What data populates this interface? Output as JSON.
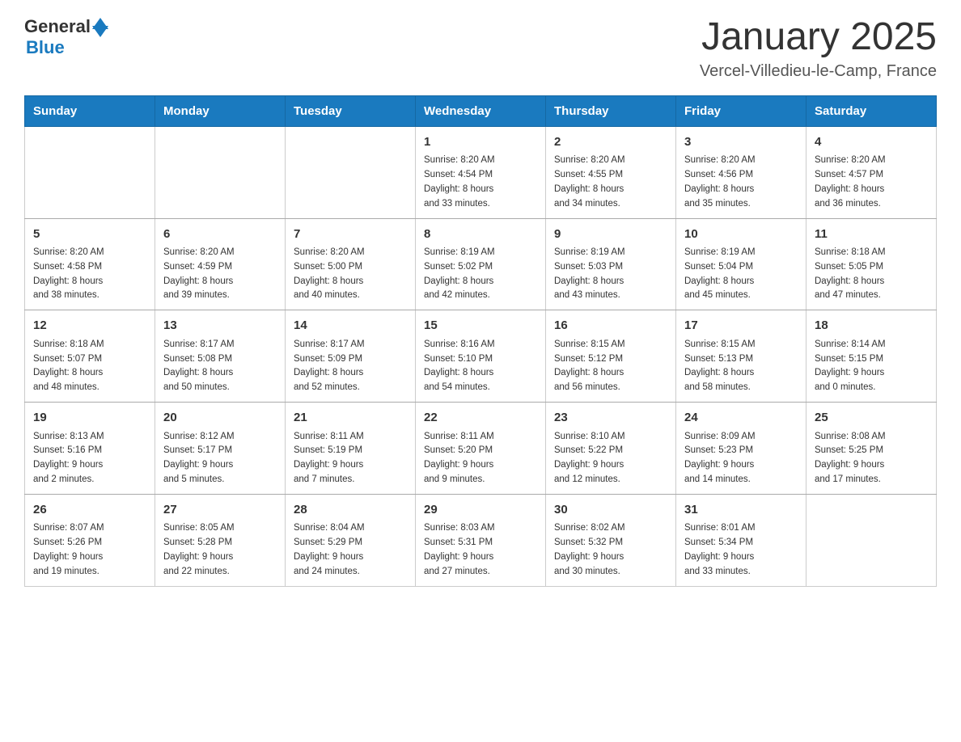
{
  "logo": {
    "general": "General",
    "blue": "Blue"
  },
  "title": "January 2025",
  "location": "Vercel-Villedieu-le-Camp, France",
  "days_of_week": [
    "Sunday",
    "Monday",
    "Tuesday",
    "Wednesday",
    "Thursday",
    "Friday",
    "Saturday"
  ],
  "weeks": [
    [
      {
        "num": "",
        "info": ""
      },
      {
        "num": "",
        "info": ""
      },
      {
        "num": "",
        "info": ""
      },
      {
        "num": "1",
        "info": "Sunrise: 8:20 AM\nSunset: 4:54 PM\nDaylight: 8 hours\nand 33 minutes."
      },
      {
        "num": "2",
        "info": "Sunrise: 8:20 AM\nSunset: 4:55 PM\nDaylight: 8 hours\nand 34 minutes."
      },
      {
        "num": "3",
        "info": "Sunrise: 8:20 AM\nSunset: 4:56 PM\nDaylight: 8 hours\nand 35 minutes."
      },
      {
        "num": "4",
        "info": "Sunrise: 8:20 AM\nSunset: 4:57 PM\nDaylight: 8 hours\nand 36 minutes."
      }
    ],
    [
      {
        "num": "5",
        "info": "Sunrise: 8:20 AM\nSunset: 4:58 PM\nDaylight: 8 hours\nand 38 minutes."
      },
      {
        "num": "6",
        "info": "Sunrise: 8:20 AM\nSunset: 4:59 PM\nDaylight: 8 hours\nand 39 minutes."
      },
      {
        "num": "7",
        "info": "Sunrise: 8:20 AM\nSunset: 5:00 PM\nDaylight: 8 hours\nand 40 minutes."
      },
      {
        "num": "8",
        "info": "Sunrise: 8:19 AM\nSunset: 5:02 PM\nDaylight: 8 hours\nand 42 minutes."
      },
      {
        "num": "9",
        "info": "Sunrise: 8:19 AM\nSunset: 5:03 PM\nDaylight: 8 hours\nand 43 minutes."
      },
      {
        "num": "10",
        "info": "Sunrise: 8:19 AM\nSunset: 5:04 PM\nDaylight: 8 hours\nand 45 minutes."
      },
      {
        "num": "11",
        "info": "Sunrise: 8:18 AM\nSunset: 5:05 PM\nDaylight: 8 hours\nand 47 minutes."
      }
    ],
    [
      {
        "num": "12",
        "info": "Sunrise: 8:18 AM\nSunset: 5:07 PM\nDaylight: 8 hours\nand 48 minutes."
      },
      {
        "num": "13",
        "info": "Sunrise: 8:17 AM\nSunset: 5:08 PM\nDaylight: 8 hours\nand 50 minutes."
      },
      {
        "num": "14",
        "info": "Sunrise: 8:17 AM\nSunset: 5:09 PM\nDaylight: 8 hours\nand 52 minutes."
      },
      {
        "num": "15",
        "info": "Sunrise: 8:16 AM\nSunset: 5:10 PM\nDaylight: 8 hours\nand 54 minutes."
      },
      {
        "num": "16",
        "info": "Sunrise: 8:15 AM\nSunset: 5:12 PM\nDaylight: 8 hours\nand 56 minutes."
      },
      {
        "num": "17",
        "info": "Sunrise: 8:15 AM\nSunset: 5:13 PM\nDaylight: 8 hours\nand 58 minutes."
      },
      {
        "num": "18",
        "info": "Sunrise: 8:14 AM\nSunset: 5:15 PM\nDaylight: 9 hours\nand 0 minutes."
      }
    ],
    [
      {
        "num": "19",
        "info": "Sunrise: 8:13 AM\nSunset: 5:16 PM\nDaylight: 9 hours\nand 2 minutes."
      },
      {
        "num": "20",
        "info": "Sunrise: 8:12 AM\nSunset: 5:17 PM\nDaylight: 9 hours\nand 5 minutes."
      },
      {
        "num": "21",
        "info": "Sunrise: 8:11 AM\nSunset: 5:19 PM\nDaylight: 9 hours\nand 7 minutes."
      },
      {
        "num": "22",
        "info": "Sunrise: 8:11 AM\nSunset: 5:20 PM\nDaylight: 9 hours\nand 9 minutes."
      },
      {
        "num": "23",
        "info": "Sunrise: 8:10 AM\nSunset: 5:22 PM\nDaylight: 9 hours\nand 12 minutes."
      },
      {
        "num": "24",
        "info": "Sunrise: 8:09 AM\nSunset: 5:23 PM\nDaylight: 9 hours\nand 14 minutes."
      },
      {
        "num": "25",
        "info": "Sunrise: 8:08 AM\nSunset: 5:25 PM\nDaylight: 9 hours\nand 17 minutes."
      }
    ],
    [
      {
        "num": "26",
        "info": "Sunrise: 8:07 AM\nSunset: 5:26 PM\nDaylight: 9 hours\nand 19 minutes."
      },
      {
        "num": "27",
        "info": "Sunrise: 8:05 AM\nSunset: 5:28 PM\nDaylight: 9 hours\nand 22 minutes."
      },
      {
        "num": "28",
        "info": "Sunrise: 8:04 AM\nSunset: 5:29 PM\nDaylight: 9 hours\nand 24 minutes."
      },
      {
        "num": "29",
        "info": "Sunrise: 8:03 AM\nSunset: 5:31 PM\nDaylight: 9 hours\nand 27 minutes."
      },
      {
        "num": "30",
        "info": "Sunrise: 8:02 AM\nSunset: 5:32 PM\nDaylight: 9 hours\nand 30 minutes."
      },
      {
        "num": "31",
        "info": "Sunrise: 8:01 AM\nSunset: 5:34 PM\nDaylight: 9 hours\nand 33 minutes."
      },
      {
        "num": "",
        "info": ""
      }
    ]
  ]
}
